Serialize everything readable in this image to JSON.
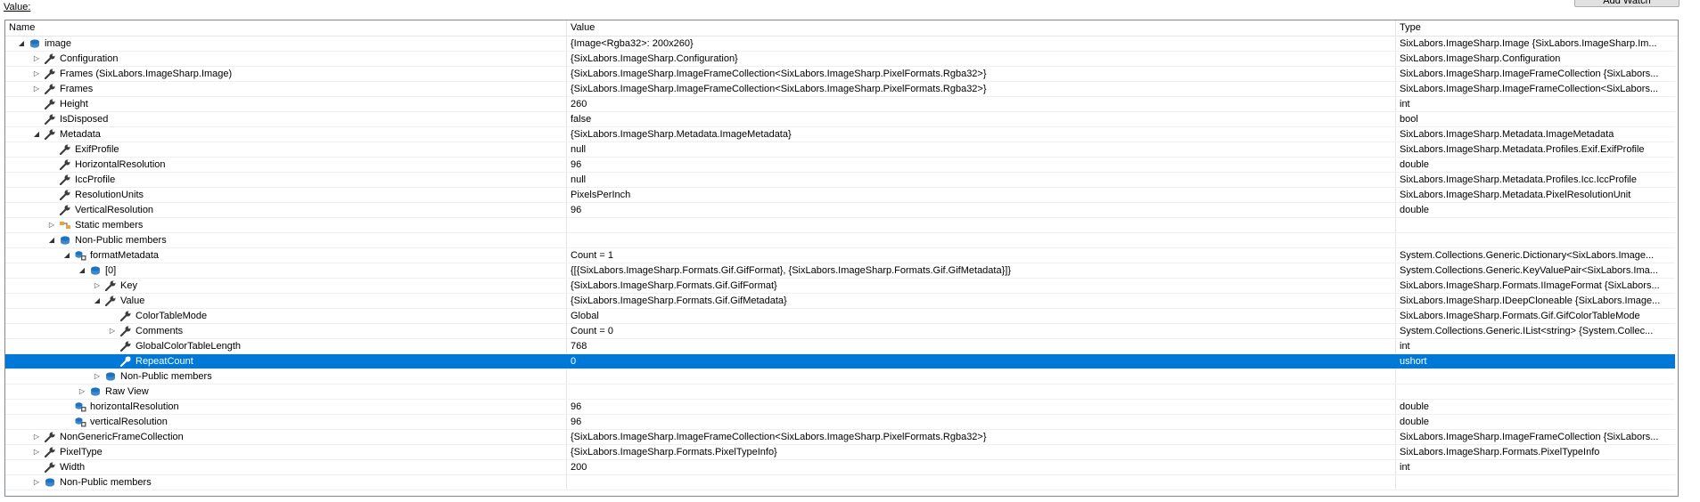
{
  "panel": {
    "value_label": "Value:",
    "add_watch_label": "Add Watch"
  },
  "columns": {
    "name": "Name",
    "value": "Value",
    "type": "Type"
  },
  "rows": [
    {
      "name": "image",
      "value": "{Image<Rgba32>: 200x260}",
      "type": "SixLabors.ImageSharp.Image {SixLabors.ImageSharp.Im...",
      "level": 0,
      "expander": "open",
      "icon": "object-icon"
    },
    {
      "name": "Configuration",
      "value": "{SixLabors.ImageSharp.Configuration}",
      "type": "SixLabors.ImageSharp.Configuration",
      "level": 1,
      "expander": "closed",
      "icon": "property-icon"
    },
    {
      "name": "Frames (SixLabors.ImageSharp.Image)",
      "value": "{SixLabors.ImageSharp.ImageFrameCollection<SixLabors.ImageSharp.PixelFormats.Rgba32>}",
      "type": "SixLabors.ImageSharp.ImageFrameCollection {SixLabors...",
      "level": 1,
      "expander": "closed",
      "icon": "property-icon"
    },
    {
      "name": "Frames",
      "value": "{SixLabors.ImageSharp.ImageFrameCollection<SixLabors.ImageSharp.PixelFormats.Rgba32>}",
      "type": "SixLabors.ImageSharp.ImageFrameCollection<SixLabors...",
      "level": 1,
      "expander": "closed",
      "icon": "property-icon"
    },
    {
      "name": "Height",
      "value": "260",
      "type": "int",
      "level": 1,
      "expander": "none",
      "icon": "property-icon"
    },
    {
      "name": "IsDisposed",
      "value": "false",
      "type": "bool",
      "level": 1,
      "expander": "none",
      "icon": "property-icon"
    },
    {
      "name": "Metadata",
      "value": "{SixLabors.ImageSharp.Metadata.ImageMetadata}",
      "type": "SixLabors.ImageSharp.Metadata.ImageMetadata",
      "level": 1,
      "expander": "open",
      "icon": "property-icon"
    },
    {
      "name": "ExifProfile",
      "value": "null",
      "type": "SixLabors.ImageSharp.Metadata.Profiles.Exif.ExifProfile",
      "level": 2,
      "expander": "none",
      "icon": "property-icon"
    },
    {
      "name": "HorizontalResolution",
      "value": "96",
      "type": "double",
      "level": 2,
      "expander": "none",
      "icon": "property-icon"
    },
    {
      "name": "IccProfile",
      "value": "null",
      "type": "SixLabors.ImageSharp.Metadata.Profiles.Icc.IccProfile",
      "level": 2,
      "expander": "none",
      "icon": "property-icon"
    },
    {
      "name": "ResolutionUnits",
      "value": "PixelsPerInch",
      "type": "SixLabors.ImageSharp.Metadata.PixelResolutionUnit",
      "level": 2,
      "expander": "none",
      "icon": "property-icon"
    },
    {
      "name": "VerticalResolution",
      "value": "96",
      "type": "double",
      "level": 2,
      "expander": "none",
      "icon": "property-icon"
    },
    {
      "name": "Static members",
      "value": "",
      "type": "",
      "level": 2,
      "expander": "closed",
      "icon": "static-members-icon"
    },
    {
      "name": "Non-Public members",
      "value": "",
      "type": "",
      "level": 2,
      "expander": "open",
      "icon": "object-icon"
    },
    {
      "name": "formatMetadata",
      "value": "Count = 1",
      "type": "System.Collections.Generic.Dictionary<SixLabors.Image...",
      "level": 3,
      "expander": "open",
      "icon": "field-icon"
    },
    {
      "name": "[0]",
      "value": "{[{SixLabors.ImageSharp.Formats.Gif.GifFormat}, {SixLabors.ImageSharp.Formats.Gif.GifMetadata}]}",
      "type": "System.Collections.Generic.KeyValuePair<SixLabors.Ima...",
      "level": 4,
      "expander": "open",
      "icon": "object-icon"
    },
    {
      "name": "Key",
      "value": "{SixLabors.ImageSharp.Formats.Gif.GifFormat}",
      "type": "SixLabors.ImageSharp.Formats.IImageFormat {SixLabors...",
      "level": 5,
      "expander": "closed",
      "icon": "property-icon"
    },
    {
      "name": "Value",
      "value": "{SixLabors.ImageSharp.Formats.Gif.GifMetadata}",
      "type": "SixLabors.ImageSharp.IDeepCloneable {SixLabors.Image...",
      "level": 5,
      "expander": "open",
      "icon": "property-icon"
    },
    {
      "name": "ColorTableMode",
      "value": "Global",
      "type": "SixLabors.ImageSharp.Formats.Gif.GifColorTableMode",
      "level": 6,
      "expander": "none",
      "icon": "property-icon"
    },
    {
      "name": "Comments",
      "value": "Count = 0",
      "type": "System.Collections.Generic.IList<string> {System.Collec...",
      "level": 6,
      "expander": "closed",
      "icon": "property-icon"
    },
    {
      "name": "GlobalColorTableLength",
      "value": "768",
      "type": "int",
      "level": 6,
      "expander": "none",
      "icon": "property-icon"
    },
    {
      "name": "RepeatCount",
      "value": "0",
      "type": "ushort",
      "level": 6,
      "expander": "none",
      "icon": "property-icon",
      "selected": true
    },
    {
      "name": "Non-Public members",
      "value": "",
      "type": "",
      "level": 5,
      "expander": "closed",
      "icon": "object-icon"
    },
    {
      "name": "Raw View",
      "value": "",
      "type": "",
      "level": 4,
      "expander": "closed",
      "icon": "object-icon"
    },
    {
      "name": "horizontalResolution",
      "value": "96",
      "type": "double",
      "level": 3,
      "expander": "none",
      "icon": "field-icon"
    },
    {
      "name": "verticalResolution",
      "value": "96",
      "type": "double",
      "level": 3,
      "expander": "none",
      "icon": "field-icon"
    },
    {
      "name": "NonGenericFrameCollection",
      "value": "{SixLabors.ImageSharp.ImageFrameCollection<SixLabors.ImageSharp.PixelFormats.Rgba32>}",
      "type": "SixLabors.ImageSharp.ImageFrameCollection {SixLabors...",
      "level": 1,
      "expander": "closed",
      "icon": "property-icon"
    },
    {
      "name": "PixelType",
      "value": "{SixLabors.ImageSharp.Formats.PixelTypeInfo}",
      "type": "SixLabors.ImageSharp.Formats.PixelTypeInfo",
      "level": 1,
      "expander": "closed",
      "icon": "property-icon"
    },
    {
      "name": "Width",
      "value": "200",
      "type": "int",
      "level": 1,
      "expander": "none",
      "icon": "property-icon"
    },
    {
      "name": "Non-Public members",
      "value": "",
      "type": "",
      "level": 1,
      "expander": "closed",
      "icon": "object-icon"
    }
  ],
  "colors": {
    "selection": "#0078d7",
    "object_icon": "#1e73be",
    "wrench": "#3c3c3c",
    "static_icon": "#e8a33a"
  }
}
